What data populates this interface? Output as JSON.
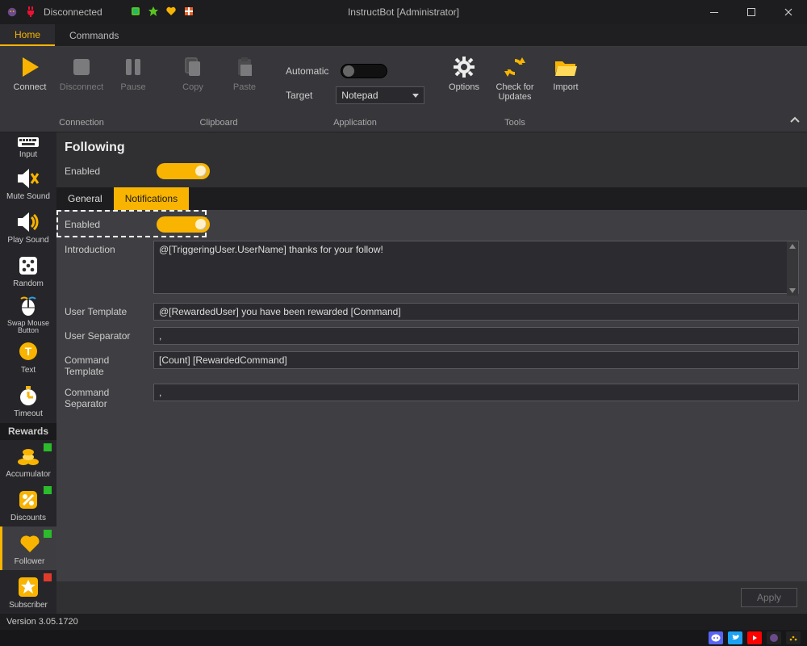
{
  "window": {
    "title": "InstructBot [Administrator]",
    "connection_status": "Disconnected"
  },
  "menutabs": {
    "home": "Home",
    "commands": "Commands"
  },
  "ribbon": {
    "connection": {
      "caption": "Connection",
      "connect": "Connect",
      "disconnect": "Disconnect",
      "pause": "Pause"
    },
    "clipboard": {
      "caption": "Clipboard",
      "copy": "Copy",
      "paste": "Paste"
    },
    "application": {
      "caption": "Application",
      "automatic": "Automatic",
      "target": "Target",
      "target_value": "Notepad"
    },
    "tools": {
      "caption": "Tools",
      "options": "Options",
      "check_updates": "Check for\nUpdates",
      "import": "Import"
    }
  },
  "sidebar": {
    "rewards_header": "Rewards",
    "items": {
      "input": {
        "label": "Input"
      },
      "mute_sound": {
        "label": "Mute Sound"
      },
      "play_sound": {
        "label": "Play Sound"
      },
      "random": {
        "label": "Random"
      },
      "swap_mouse": {
        "label": "Swap Mouse\nButton"
      },
      "text": {
        "label": "Text"
      },
      "timeout": {
        "label": "Timeout"
      },
      "accumulator": {
        "label": "Accumulator"
      },
      "discounts": {
        "label": "Discounts"
      },
      "follower": {
        "label": "Follower"
      },
      "subscriber": {
        "label": "Subscriber"
      }
    }
  },
  "page": {
    "title": "Following",
    "enabled_label": "Enabled",
    "tabs": {
      "general": "General",
      "notifications": "Notifications"
    },
    "notif_enabled_label": "Enabled",
    "fields": {
      "introduction": {
        "label": "Introduction",
        "value": "@[TriggeringUser.UserName] thanks for your follow!"
      },
      "user_template": {
        "label": "User Template",
        "value": "@[RewardedUser] you have been rewarded [Command]"
      },
      "user_separator": {
        "label": "User Separator",
        "value": ","
      },
      "command_template": {
        "label": "Command Template",
        "value": "[Count] [RewardedCommand]"
      },
      "command_separator": {
        "label": "Command Separator",
        "value": ","
      }
    },
    "apply": "Apply"
  },
  "status": {
    "version": "Version 3.05.1720"
  }
}
